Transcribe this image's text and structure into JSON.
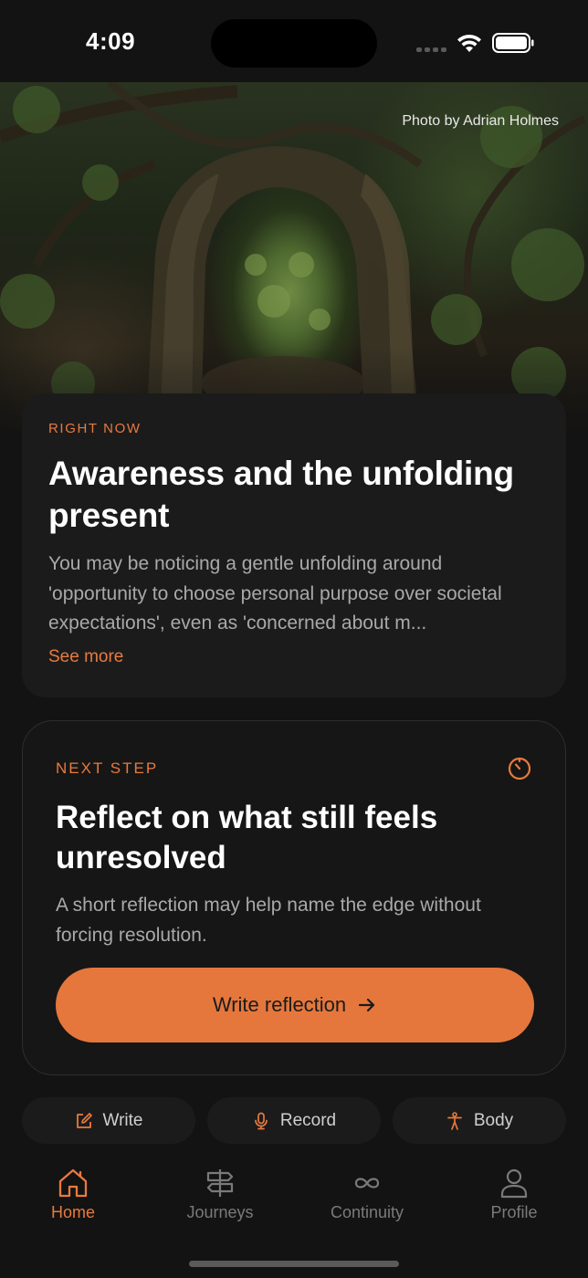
{
  "status_bar": {
    "time": "4:09"
  },
  "hero": {
    "photo_credit": "Photo by Adrian Holmes"
  },
  "right_now": {
    "eyebrow": "RIGHT NOW",
    "title": "Awareness and the unfolding present",
    "body": "You may be noticing a gentle unfolding around 'opportunity to choose personal purpose over societal expectations', even as 'concerned about m...",
    "see_more": "See more"
  },
  "next_step": {
    "eyebrow": "NEXT STEP",
    "icon": "timer-icon",
    "title": "Reflect on what still feels unresolved",
    "body": "A short reflection may help name the edge without forcing resolution.",
    "cta_label": "Write reflection"
  },
  "quick_actions": [
    {
      "label": "Write",
      "icon": "edit-icon"
    },
    {
      "label": "Record",
      "icon": "microphone-icon"
    },
    {
      "label": "Body",
      "icon": "body-icon"
    }
  ],
  "nav": [
    {
      "label": "Home",
      "icon": "home-icon",
      "active": true
    },
    {
      "label": "Journeys",
      "icon": "signpost-icon",
      "active": false
    },
    {
      "label": "Continuity",
      "icon": "infinity-icon",
      "active": false
    },
    {
      "label": "Profile",
      "icon": "person-icon",
      "active": false
    }
  ],
  "colors": {
    "accent": "#e87a3e",
    "cta": "#e5773d",
    "background": "#131313",
    "card": "#1c1b1b"
  }
}
